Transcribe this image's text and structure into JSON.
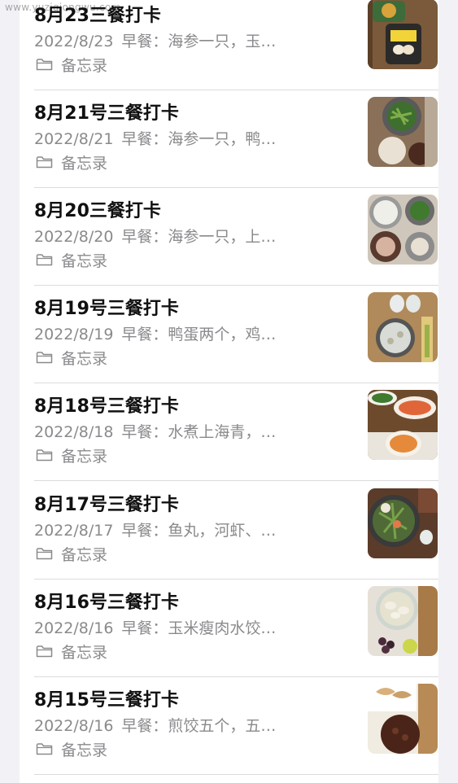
{
  "watermark": "www.yuziqiongwu.com",
  "folder_label": "备忘录",
  "notes": [
    {
      "title": "8月23三餐打卡",
      "date": "2022/8/23",
      "preview": "早餐：海参一只，玉…"
    },
    {
      "title": "8月21号三餐打卡",
      "date": "2022/8/21",
      "preview": "早餐：海参一只，鸭…"
    },
    {
      "title": "8月20三餐打卡",
      "date": "2022/8/20",
      "preview": "早餐：海参一只，上…"
    },
    {
      "title": "8月19号三餐打卡",
      "date": "2022/8/19",
      "preview": "早餐：鸭蛋两个，鸡…"
    },
    {
      "title": "8月18号三餐打卡",
      "date": "2022/8/18",
      "preview": "早餐：水煮上海青，…"
    },
    {
      "title": "8月17号三餐打卡",
      "date": "2022/8/17",
      "preview": "早餐：鱼丸，河虾、…"
    },
    {
      "title": "8月16号三餐打卡",
      "date": "2022/8/16",
      "preview": "早餐：玉米瘦肉水饺…"
    },
    {
      "title": "8月15号三餐打卡",
      "date": "2022/8/16",
      "preview": "早餐：煎饺五个，五…"
    }
  ]
}
